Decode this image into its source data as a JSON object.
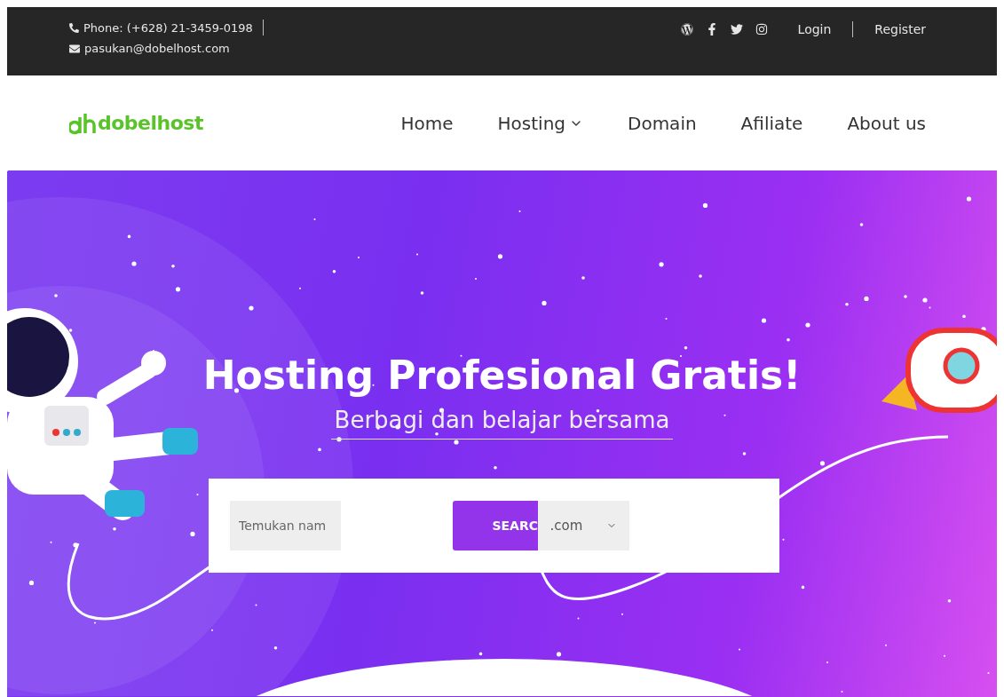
{
  "top_bar": {
    "phone": "Phone: (+628) 21-3459-0198",
    "email": "pasukan@dobelhost.com",
    "social": [
      {
        "kind": "wordpress"
      },
      {
        "kind": "facebook"
      },
      {
        "kind": "twitter"
      },
      {
        "kind": "instagram"
      }
    ],
    "links": [
      "Login",
      "Register"
    ]
  },
  "header": {
    "logo": "dobelhost",
    "nav": [
      {
        "label": "Home",
        "has_menu": false
      },
      {
        "label": "Hosting",
        "has_menu": true
      },
      {
        "label": "Domain",
        "has_menu": false
      },
      {
        "label": "Afiliate",
        "has_menu": false
      },
      {
        "label": "About us",
        "has_menu": false
      }
    ]
  },
  "hero": {
    "title": "Hosting Profesional Gratis!",
    "subtitle": "Berbagi dan belajar bersama",
    "search": {
      "placeholder": "Temukan nam",
      "button": "SEARC",
      "tld": ".com"
    }
  }
}
